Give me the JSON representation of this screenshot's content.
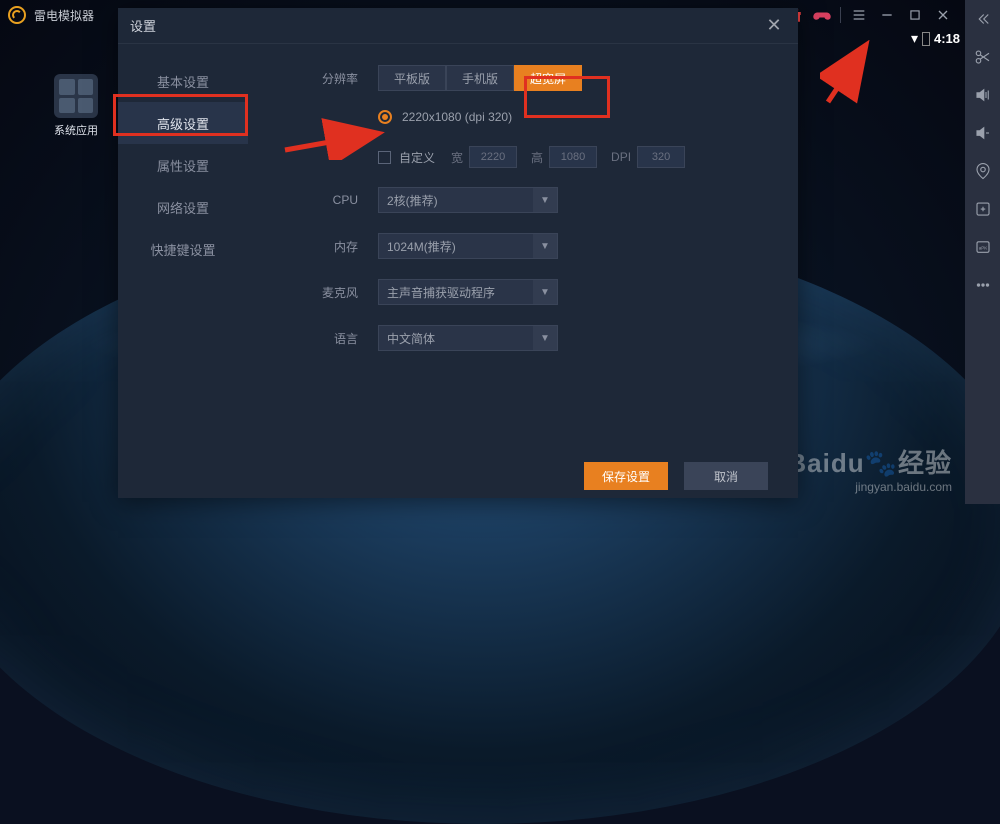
{
  "titlebar": {
    "app_name": "雷电模拟器"
  },
  "desktop": {
    "icon_label": "系统应用"
  },
  "android": {
    "time": "4:18"
  },
  "dialog": {
    "title": "设置",
    "nav": [
      "基本设置",
      "高级设置",
      "属性设置",
      "网络设置",
      "快捷键设置"
    ],
    "resolution": {
      "label": "分辨率",
      "tabs": [
        "平板版",
        "手机版",
        "超宽屏"
      ],
      "radio_label": "2220x1080 (dpi 320)"
    },
    "custom": {
      "label": "自定义",
      "width_label": "宽",
      "width_val": "2220",
      "height_label": "高",
      "height_val": "1080",
      "dpi_label": "DPI",
      "dpi_val": "320"
    },
    "cpu": {
      "label": "CPU",
      "value": "2核(推荐)"
    },
    "memory": {
      "label": "内存",
      "value": "1024M(推荐)"
    },
    "mic": {
      "label": "麦克风",
      "value": "主声音捕获驱动程序"
    },
    "lang": {
      "label": "语言",
      "value": "中文简体"
    },
    "save": "保存设置",
    "cancel": "取消"
  },
  "watermark": {
    "brand": "Baidu",
    "suffix": "经验",
    "url": "jingyan.baidu.com"
  }
}
